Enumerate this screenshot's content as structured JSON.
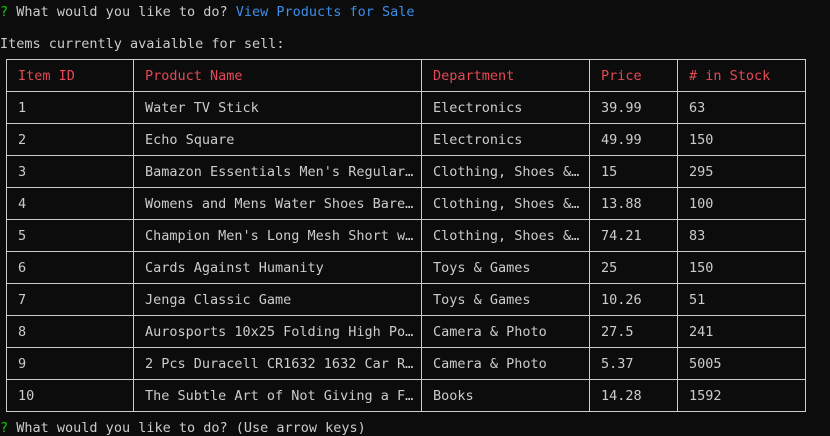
{
  "prompt1": {
    "marker": "?",
    "question": "What would you like to do?",
    "answer": "View Products for Sale"
  },
  "subtitle": "Items currently avaialble for sell:",
  "table": {
    "headers": [
      "Item ID",
      "Product Name",
      "Department",
      "Price",
      "# in Stock"
    ],
    "rows": [
      [
        "1",
        "Water TV Stick",
        "Electronics",
        "39.99",
        "63"
      ],
      [
        "2",
        "Echo Square",
        "Electronics",
        "49.99",
        "150"
      ],
      [
        "3",
        "Bamazon Essentials Men's Regular…",
        "Clothing, Shoes &…",
        "15",
        "295"
      ],
      [
        "4",
        "Womens and Mens Water Shoes Bare…",
        "Clothing, Shoes &…",
        "13.88",
        "100"
      ],
      [
        "5",
        "Champion Men's Long Mesh Short w…",
        "Clothing, Shoes &…",
        "74.21",
        "83"
      ],
      [
        "6",
        "Cards Against Humanity",
        "Toys & Games",
        "25",
        "150"
      ],
      [
        "7",
        "Jenga Classic Game",
        "Toys & Games",
        "10.26",
        "51"
      ],
      [
        "8",
        "Aurosports 10x25 Folding High Po…",
        "Camera & Photo",
        "27.5",
        "241"
      ],
      [
        "9",
        "2 Pcs Duracell CR1632 1632 Car R…",
        "Camera & Photo",
        "5.37",
        "5005"
      ],
      [
        "10",
        "The Subtle Art of Not Giving a F…",
        "Books",
        "14.28",
        "1592"
      ]
    ]
  },
  "prompt2": {
    "marker": "?",
    "question": "What would you like to do?",
    "hint": "(Use arrow keys)"
  },
  "colors": {
    "background": "#0c0c0c",
    "text": "#cccccc",
    "prompt_marker": "#16c60c",
    "answer": "#3b8eea",
    "header": "#e74856"
  }
}
